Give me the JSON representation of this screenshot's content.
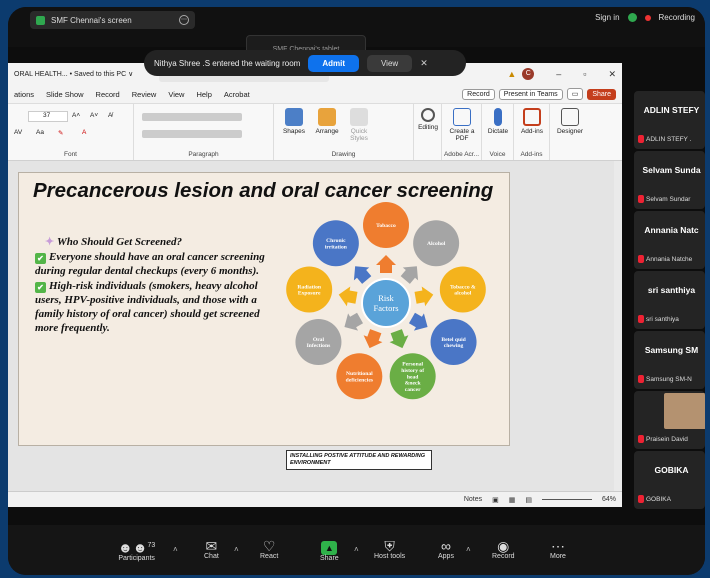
{
  "zoom": {
    "share_label": "SMF Chennai's screen",
    "sign_in": "Sign in",
    "recording": "Recording",
    "ghost_tab": "SMF Chennai's tablet",
    "waiting": {
      "message": "Nithya Shree .S entered the waiting room",
      "admit": "Admit",
      "view": "View"
    }
  },
  "ppt": {
    "doc_title": "ORAL HEALTH... • Saved to this PC ∨",
    "search_placeholder": "Search",
    "avatar_letter": "C",
    "menu": [
      "ations",
      "Slide Show",
      "Record",
      "Review",
      "View",
      "Help",
      "Acrobat"
    ],
    "record_btn": "Record",
    "present_btn": "Present in Teams",
    "share_btn": "Share",
    "ribbon": {
      "font_size": "37",
      "font_label": "Font",
      "paragraph_label": "Paragraph",
      "drawing_label": "Drawing",
      "shapes": "Shapes",
      "arrange": "Arrange",
      "quick_styles": "Quick Styles",
      "editing": "Editing",
      "create_pdf": "Create a PDF",
      "adobe_label": "Adobe Acr...",
      "dictate": "Dictate",
      "voice_label": "Voice",
      "addins": "Add-ins",
      "addins_label": "Add-ins",
      "designer": "Designer"
    },
    "slide": {
      "title": "Precancerous lesion and oral cancer screening",
      "q1": "Who Should Get Screened?",
      "b1": "Everyone should have an oral cancer screening during regular dental checkups (every 6 months).",
      "b2": "High-risk individuals (smokers, heavy alcohol users, HPV-positive individuals, and those with a family history of oral cancer) should get screened more frequently.",
      "center": [
        "Risk",
        "Factors"
      ],
      "factors": [
        {
          "lines": [
            "Tobacco"
          ],
          "color": "#ef7d2f"
        },
        {
          "lines": [
            "Alcohol"
          ],
          "color": "#a5a5a5"
        },
        {
          "lines": [
            "Tobacco &",
            "alcohol"
          ],
          "color": "#f4b31c"
        },
        {
          "lines": [
            "Betel quid",
            "chewing"
          ],
          "color": "#4a76c6"
        },
        {
          "lines": [
            "Personal",
            "history of",
            "head",
            "&neck",
            "cancer"
          ],
          "color": "#6aae45"
        },
        {
          "lines": [
            "Nutritional",
            "deficiencies"
          ],
          "color": "#ef7d2f"
        },
        {
          "lines": [
            "Oral",
            "Infections"
          ],
          "color": "#a5a5a5"
        },
        {
          "lines": [
            "Radiation",
            "Exposure"
          ],
          "color": "#f4b31c"
        },
        {
          "lines": [
            "Chronic",
            "irritation"
          ],
          "color": "#4a76c6"
        }
      ]
    },
    "caption": "INSTALLING POSTIVE ATTITUDE AND REWARDING ENVIRONMENT",
    "status": {
      "notes": "Notes",
      "zoom": "64%"
    }
  },
  "participants": [
    {
      "name": "ADLIN STEFY",
      "tag": "ADLIN STEFY ."
    },
    {
      "name": "Selvam Sunda",
      "tag": "Selvam Sundar"
    },
    {
      "name": "Annania Natc",
      "tag": "Annania Natche"
    },
    {
      "name": "sri santhiya",
      "tag": "sri santhiya"
    },
    {
      "name": "Samsung SM",
      "tag": "Samsung SM-N"
    },
    {
      "name": "",
      "tag": "Praisein David"
    },
    {
      "name": "GOBIKA",
      "tag": "GOBIKA"
    }
  ],
  "toolbar": {
    "participants_label": "Participants",
    "participant_count": "73",
    "chat": "Chat",
    "react": "React",
    "share": "Share",
    "host_tools": "Host tools",
    "apps": "Apps",
    "record": "Record",
    "more": "More"
  }
}
